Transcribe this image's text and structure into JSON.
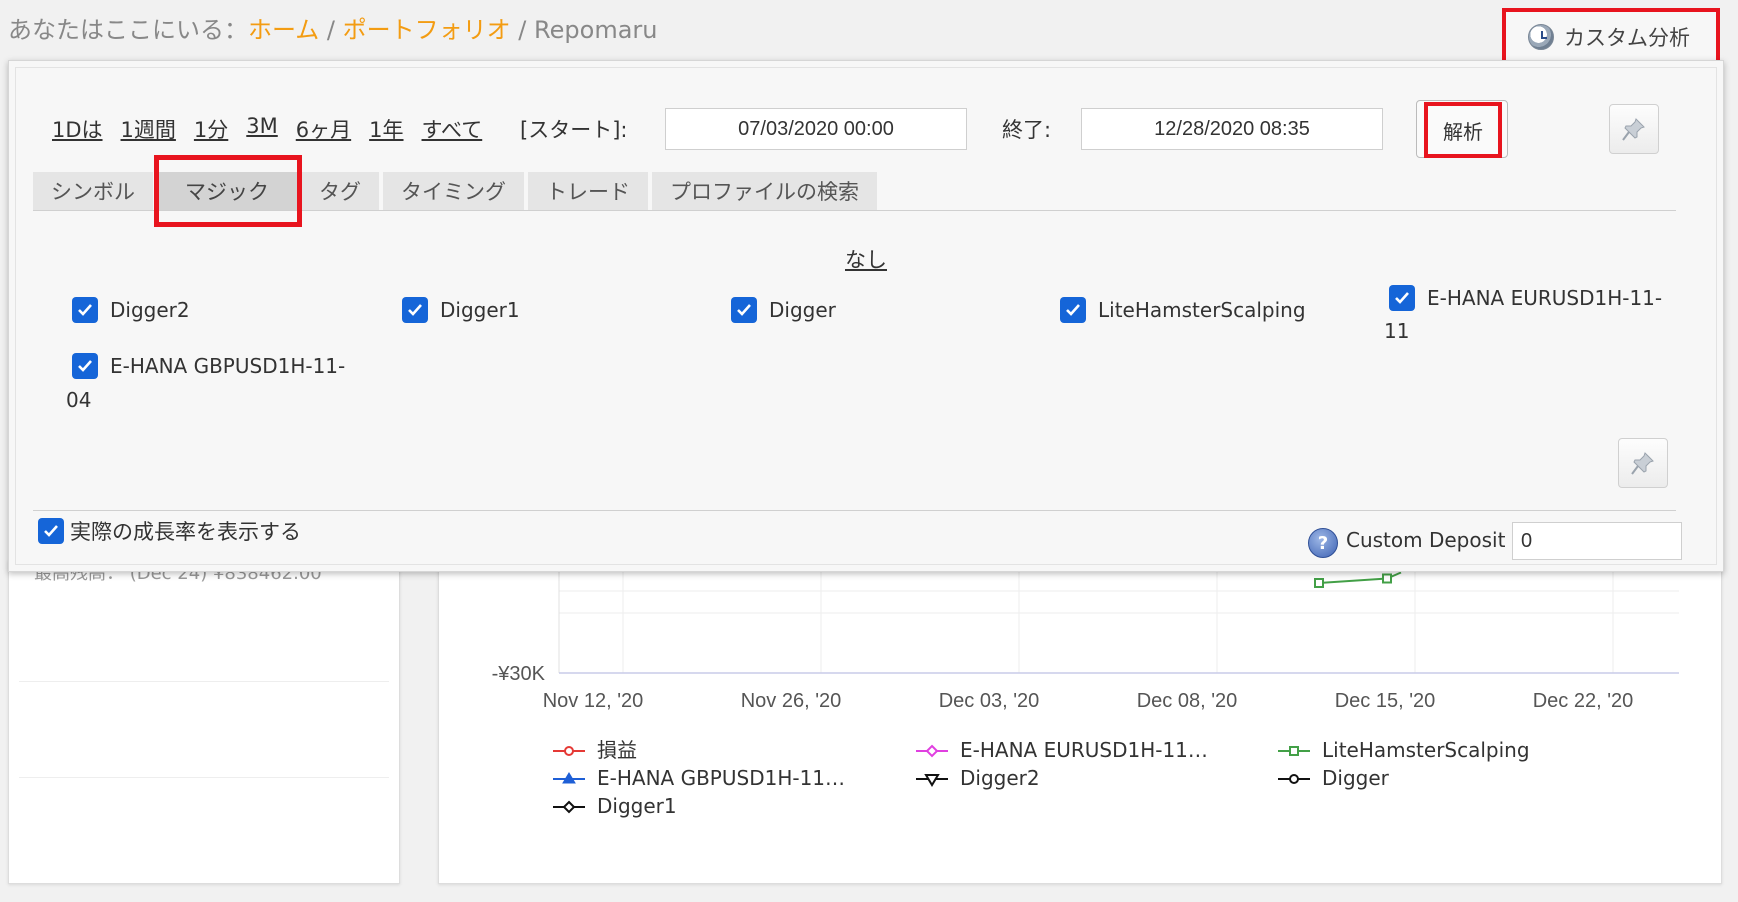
{
  "breadcrumb": {
    "prefix": "あなたはここにいる：",
    "home": "ホーム",
    "portfolio": "ポートフォリオ",
    "separator": "/",
    "current": "Repomaru"
  },
  "custom_analysis": {
    "label": "カスタム分析",
    "icon": "clock-icon"
  },
  "time_ranges": [
    "1Dは",
    "1週間",
    "1分",
    "3M",
    "6ヶ月",
    "1年",
    "すべて"
  ],
  "date_filter": {
    "start_label": "[スタート]:",
    "start_value": "07/03/2020 00:00",
    "end_label": "終了:",
    "end_value": "12/28/2020 08:35"
  },
  "analyze_button": {
    "label": "解析"
  },
  "tabs": [
    {
      "label": "シンボル",
      "active": false
    },
    {
      "label": "マジック",
      "active": true
    },
    {
      "label": "タグ",
      "active": false
    },
    {
      "label": "タイミング",
      "active": false
    },
    {
      "label": "トレード",
      "active": false
    },
    {
      "label": "プロファイルの検索",
      "active": false
    }
  ],
  "none_link": "なし",
  "magic_items": [
    {
      "label": "Digger2",
      "checked": true
    },
    {
      "label": "Digger1",
      "checked": true
    },
    {
      "label": "Digger",
      "checked": true
    },
    {
      "label": "LiteHamsterScalping",
      "checked": true
    },
    {
      "label": "E-HANA EURUSD1H-11-",
      "tail": "11",
      "checked": true
    },
    {
      "label": "E-HANA GBPUSD1H-11-",
      "tail": "04",
      "checked": true
    }
  ],
  "growth_checkbox": {
    "label": "実際の成長率を表示する",
    "checked": true
  },
  "custom_deposit": {
    "label": "Custom Deposit",
    "value": "0"
  },
  "left_card_fragment": "最高残高：  (Dec 24) ¥838462.00",
  "colors": {
    "accent_orange": "#f39c12",
    "highlight_red": "#e8141e",
    "checkbox_blue": "#1565d8"
  },
  "chart_data": {
    "type": "line",
    "y_tick_labels": [
      "-¥30K"
    ],
    "x_tick_labels": [
      "Nov 12, '20",
      "Nov 26, '20",
      "Dec 03, '20",
      "Dec 08, '20",
      "Dec 15, '20",
      "Dec 22, '20"
    ],
    "visible_points": [
      {
        "series": "LiteHamsterScalping",
        "x": "Dec 14, '20",
        "y": -26000
      },
      {
        "series": "LiteHamsterScalping",
        "x": "Dec 15, '20",
        "y": -25800
      }
    ],
    "legend": [
      {
        "name": "損益",
        "color": "#e53935",
        "marker": "circle"
      },
      {
        "name": "E-HANA EURUSD1H-11…",
        "color": "#e040e0",
        "marker": "diamond"
      },
      {
        "name": "LiteHamsterScalping",
        "color": "#43a047",
        "marker": "square"
      },
      {
        "name": "E-HANA GBPUSD1H-11…",
        "color": "#1e5fd6",
        "marker": "triangle-up"
      },
      {
        "name": "Digger2",
        "color": "#111111",
        "marker": "triangle-down"
      },
      {
        "name": "Digger",
        "color": "#111111",
        "marker": "circle"
      },
      {
        "name": "Digger1",
        "color": "#111111",
        "marker": "diamond"
      }
    ]
  }
}
